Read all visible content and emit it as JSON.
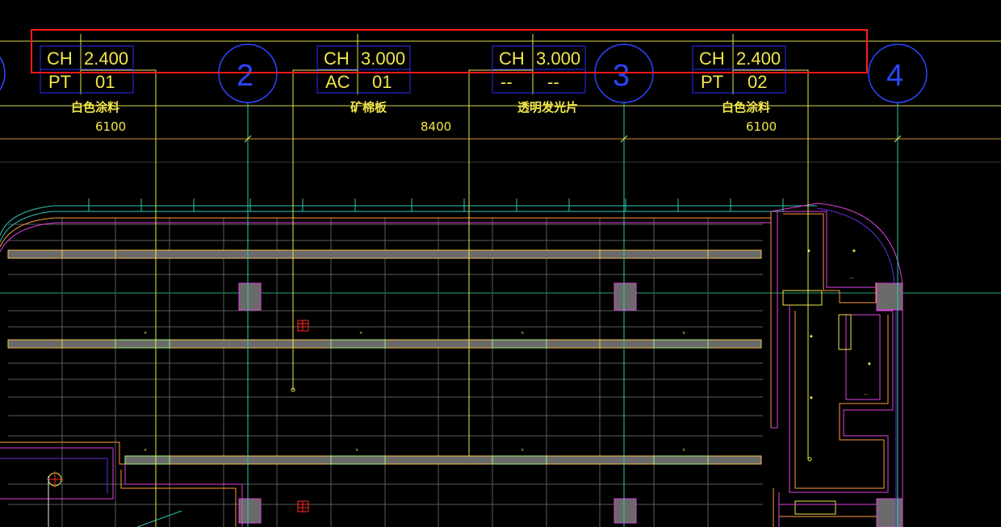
{
  "ceiling_tags": [
    {
      "row1_code": "CH",
      "row1_value": "2.400",
      "row2_code": "PT",
      "row2_value": "01",
      "material": "白色涂料"
    },
    {
      "row1_code": "CH",
      "row1_value": "3.000",
      "row2_code": "AC",
      "row2_value": "01",
      "material": "矿棉板"
    },
    {
      "row1_code": "CH",
      "row1_value": "3.000",
      "row2_code": "--",
      "row2_value": "--",
      "material": "透明发光片"
    },
    {
      "row1_code": "CH",
      "row1_value": "2.400",
      "row2_code": "PT",
      "row2_value": "02",
      "material": "白色涂料"
    }
  ],
  "grid_axes": [
    "2",
    "3",
    "4"
  ],
  "dimensions": [
    "6100",
    "8400",
    "6100"
  ],
  "colors": {
    "background": "#000000",
    "tag_border": "#2b2bff",
    "tag_text": "#f2e64a",
    "highlight": "#ff1a1a",
    "grid_bubble": "#2b46ff",
    "wall_magenta": "#e043e0",
    "wall_orange": "#ff9a3c",
    "ceiling_grid": "#7a7a7a",
    "axis_cyan": "#2ec9b5",
    "leader_yellow": "#e8e84a"
  },
  "selection_box": {
    "label": "highlighted-ceiling-tags"
  }
}
